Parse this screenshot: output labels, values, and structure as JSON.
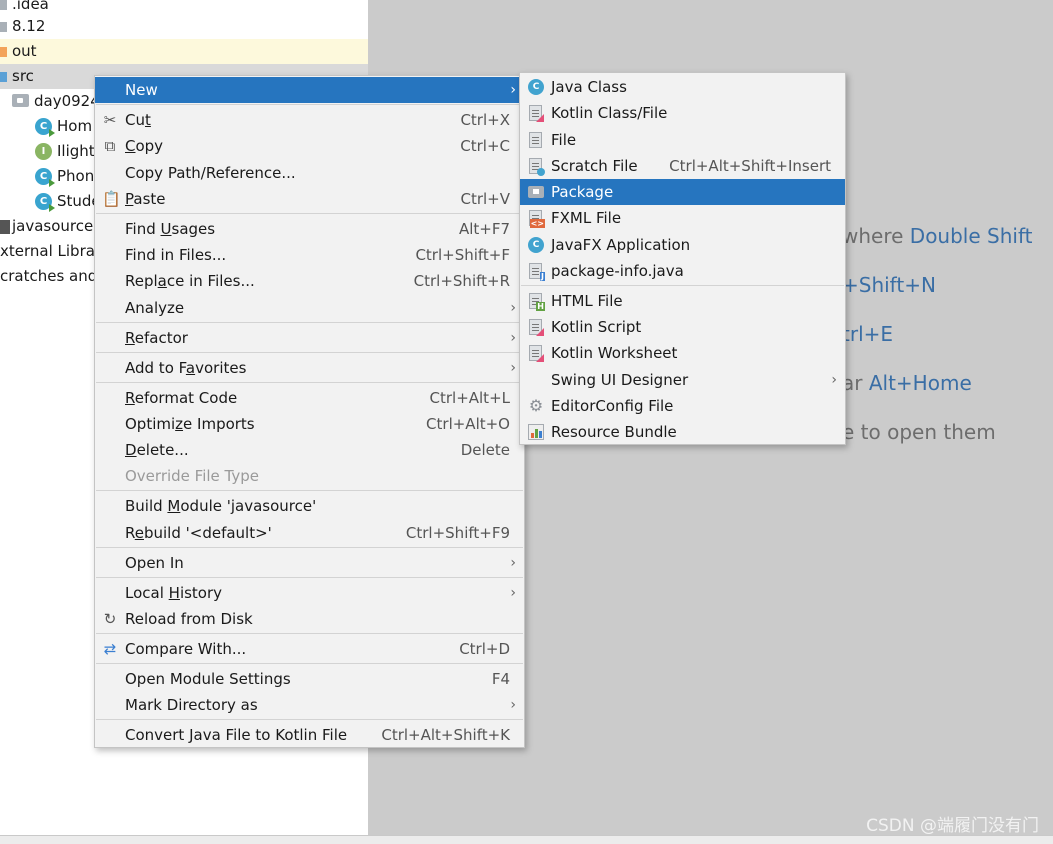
{
  "tree": {
    "items": [
      {
        "label": ".idea"
      },
      {
        "label": "8.12"
      },
      {
        "label": "out"
      },
      {
        "label": "src"
      },
      {
        "label": "day0924"
      },
      {
        "label": "Hom"
      },
      {
        "label": "Ilight"
      },
      {
        "label": "Phon"
      },
      {
        "label": "Stude"
      },
      {
        "label": "javasource."
      },
      {
        "label": "xternal Librar"
      },
      {
        "label": "cratches and"
      }
    ]
  },
  "editor_hints": {
    "search_text": "where ",
    "search_key": "Double Shift",
    "goto_file_key": "+Shift+N",
    "recent_key": "trl+E",
    "navbar_text": "ar ",
    "navbar_key": "Alt+Home",
    "drop_text": "e to open them"
  },
  "watermark": "CSDN @端履门没有门",
  "context_menu": {
    "new": "New",
    "cut": {
      "pre": "Cu",
      "u": "t",
      "post": "",
      "shortcut": "Ctrl+X"
    },
    "copy": {
      "pre": "",
      "u": "C",
      "post": "opy",
      "shortcut": "Ctrl+C"
    },
    "copy_path": "Copy Path/Reference...",
    "paste": {
      "pre": "",
      "u": "P",
      "post": "aste",
      "shortcut": "Ctrl+V"
    },
    "find_usages": {
      "pre": "Find ",
      "u": "U",
      "post": "sages",
      "shortcut": "Alt+F7"
    },
    "find_in_files": {
      "label": "Find in Files...",
      "shortcut": "Ctrl+Shift+F"
    },
    "replace_in_files": {
      "pre": "Repl",
      "u": "a",
      "post": "ce in Files...",
      "shortcut": "Ctrl+Shift+R"
    },
    "analyze": "Analyze",
    "refactor": {
      "pre": "",
      "u": "R",
      "post": "efactor"
    },
    "add_to_favorites": {
      "pre": "Add to F",
      "u": "a",
      "post": "vorites"
    },
    "reformat_code": {
      "pre": "",
      "u": "R",
      "post": "eformat Code",
      "shortcut": "Ctrl+Alt+L"
    },
    "optimize_imports": {
      "pre": "Optimi",
      "u": "z",
      "post": "e Imports",
      "shortcut": "Ctrl+Alt+O"
    },
    "delete": {
      "pre": "",
      "u": "D",
      "post": "elete...",
      "shortcut": "Delete"
    },
    "override_file_type": "Override File Type",
    "build_module": {
      "pre": "Build ",
      "u": "M",
      "post": "odule 'javasource'"
    },
    "rebuild": {
      "pre": "R",
      "u": "e",
      "post": "build '<default>'",
      "shortcut": "Ctrl+Shift+F9"
    },
    "open_in": "Open In",
    "local_history": {
      "pre": "Local ",
      "u": "H",
      "post": "istory"
    },
    "reload_from_disk": "Reload from Disk",
    "compare_with": {
      "label": "Compare With...",
      "shortcut": "Ctrl+D"
    },
    "open_module_settings": {
      "label": "Open Module Settings",
      "shortcut": "F4"
    },
    "mark_directory_as": "Mark Directory as",
    "convert_to_kotlin": {
      "label": "Convert Java File to Kotlin File",
      "shortcut": "Ctrl+Alt+Shift+K"
    }
  },
  "new_submenu": {
    "items": [
      {
        "label": "Java Class"
      },
      {
        "label": "Kotlin Class/File"
      },
      {
        "label": "File"
      },
      {
        "label": "Scratch File",
        "shortcut": "Ctrl+Alt+Shift+Insert"
      },
      {
        "label": "Package"
      },
      {
        "label": "FXML File"
      },
      {
        "label": "JavaFX Application"
      },
      {
        "label": "package-info.java"
      },
      {
        "label": "HTML File"
      },
      {
        "label": "Kotlin Script"
      },
      {
        "label": "Kotlin Worksheet"
      },
      {
        "label": "Swing UI Designer"
      },
      {
        "label": "EditorConfig File"
      },
      {
        "label": "Resource Bundle"
      }
    ]
  },
  "colors": {
    "highlight": "#2675bf",
    "editor_bg": "#cbcbcb",
    "hint_key": "#3a6ea5"
  }
}
